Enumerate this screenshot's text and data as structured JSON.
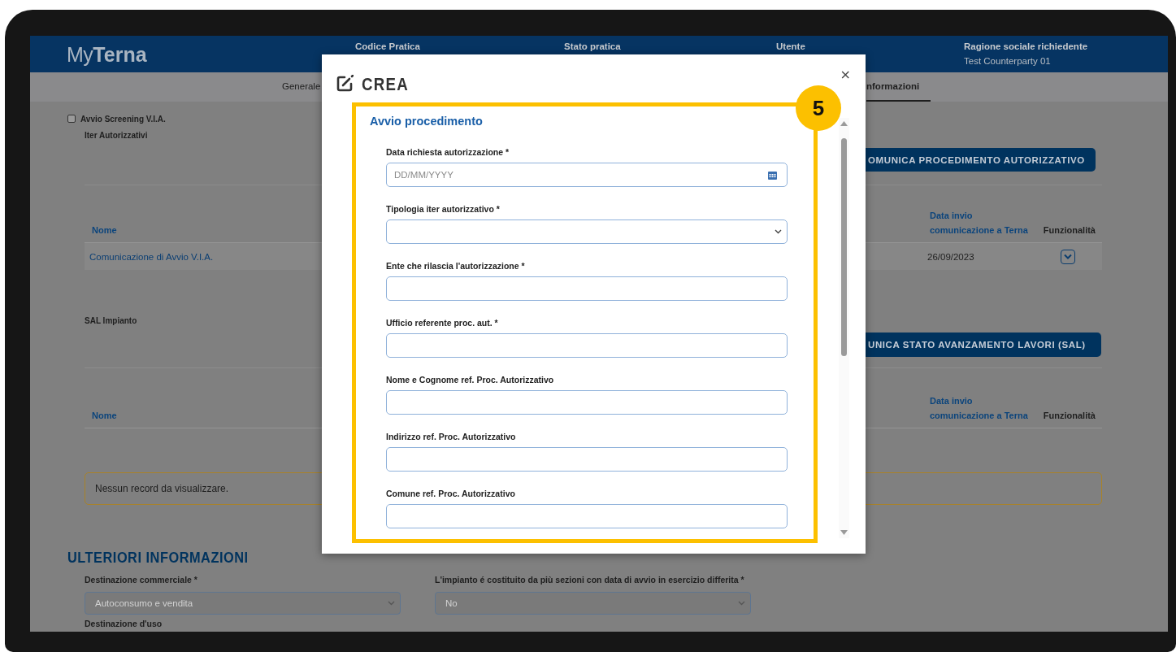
{
  "header": {
    "logo": {
      "light": "My",
      "bold": "Terna"
    },
    "columns": [
      {
        "label": "Codice Pratica"
      },
      {
        "label": "Stato pratica"
      },
      {
        "label": "Utente"
      },
      {
        "label": "Ragione sociale richiedente",
        "value": "Test Counterparty 01"
      }
    ]
  },
  "tabs": [
    {
      "label": "Generale",
      "selected": false
    },
    {
      "label": "nformazioni",
      "selected": true
    }
  ],
  "screening": {
    "label": "Avvio Screening V.I.A.",
    "checked": false
  },
  "sections": [
    {
      "title": "Iter Autorizzativi",
      "button": "OMUNICA PROCEDIMENTO AUTORIZZATIVO",
      "columns": [
        {
          "label": "Nome",
          "sortable": true
        },
        {
          "label": "Data invio comunicazione a Terna",
          "sortable": true
        },
        {
          "label": "Funzionalità",
          "sortable": false
        }
      ],
      "rows": [
        {
          "name": "Comunicazione di Avvio V.I.A.",
          "date": "26/09/2023"
        }
      ]
    },
    {
      "title": "SAL Impianto",
      "button": "UNICA STATO AVANZAMENTO LAVORI (SAL)",
      "columns": [
        {
          "label": "Nome",
          "sortable": true
        },
        {
          "label": "Data invio comunicazione a Terna",
          "sortable": true
        },
        {
          "label": "Funzionalità",
          "sortable": false
        }
      ],
      "empty_message": "Nessun record da visualizzare."
    }
  ],
  "more_info": {
    "title": "ULTERIORI INFORMAZIONI",
    "fields": [
      {
        "label": "Destinazione commerciale *",
        "value": "Autoconsumo e vendita",
        "disabled": true
      },
      {
        "label": "L'impianto é costituito da più sezioni con data di avvio in esercizio differita *",
        "value": "No",
        "disabled": true
      }
    ],
    "next_label": "Destinazione d'uso"
  },
  "modal": {
    "title": "CREA",
    "close": "×",
    "callout": "5",
    "section_title": "Avvio procedimento",
    "fields": [
      {
        "kind": "date",
        "label": "Data richiesta autorizzazione *",
        "placeholder": "DD/MM/YYYY"
      },
      {
        "kind": "select",
        "label": "Tipologia iter autorizzativo *"
      },
      {
        "kind": "text",
        "label": "Ente che rilascia l'autorizzazione *"
      },
      {
        "kind": "text",
        "label": "Ufficio referente proc. aut. *"
      },
      {
        "kind": "text",
        "label": "Nome e Cognome ref. Proc. Autorizzativo"
      },
      {
        "kind": "text",
        "label": "Indirizzo ref. Proc. Autorizzativo"
      },
      {
        "kind": "text",
        "label": "Comune ref. Proc. Autorizzativo"
      }
    ]
  }
}
